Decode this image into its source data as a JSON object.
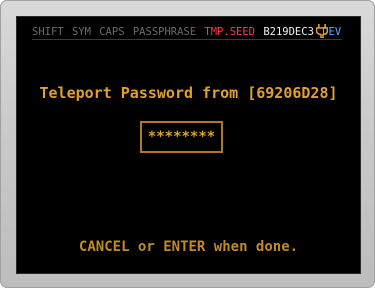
{
  "status_bar": {
    "shift": "SHIFT",
    "sym": "SYM",
    "caps": "CAPS",
    "passphrase": "PASSPHRASE",
    "tmp_seed": "TMP.SEED",
    "fingerprint": "B219DEC3",
    "dev": "DEV",
    "power_icon": "plug-icon"
  },
  "prompt": {
    "title": "Teleport Password from [69206D28]",
    "password_mask": "********",
    "footer": "CANCEL or ENTER when done."
  },
  "colors": {
    "accent": "#e0a030",
    "tmp_seed": "#ff3b3b",
    "dev": "#5aa8ff",
    "inactive": "#6a6a6a"
  }
}
